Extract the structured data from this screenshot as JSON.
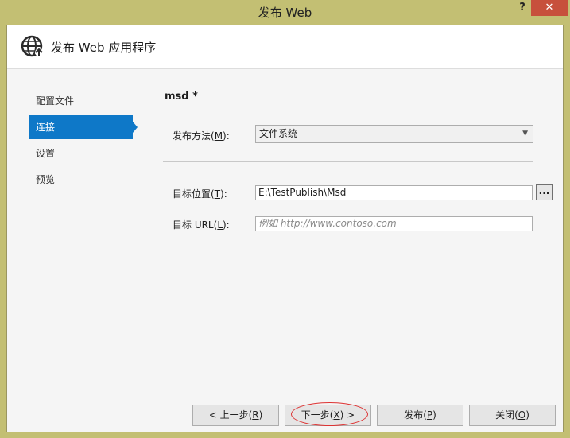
{
  "window": {
    "title": "发布 Web",
    "help_label": "?",
    "close_label": "✕"
  },
  "header": {
    "title": "发布 Web 应用程序",
    "icon": "globe-publish-icon"
  },
  "nav": {
    "items": [
      {
        "label": "配置文件",
        "active": false
      },
      {
        "label": "连接",
        "active": true
      },
      {
        "label": "设置",
        "active": false
      },
      {
        "label": "预览",
        "active": false
      }
    ]
  },
  "main": {
    "profile_name": "msd *",
    "publish_method": {
      "label_pre": "发布方法(",
      "label_key": "M",
      "label_post": "):",
      "value": "文件系统"
    },
    "target_location": {
      "label_pre": "目标位置(",
      "label_key": "T",
      "label_post": "):",
      "value": "E:\\TestPublish\\Msd",
      "browse_label": "..."
    },
    "target_url": {
      "label_pre": "目标 URL(",
      "label_key": "L",
      "label_post": "):",
      "value": "",
      "placeholder": "例如 http://www.contoso.com"
    }
  },
  "footer": {
    "prev": {
      "pre": "< 上一步(",
      "key": "R",
      "post": ")"
    },
    "next": {
      "pre": "下一步(",
      "key": "X",
      "post": ") >"
    },
    "publish": {
      "pre": "发布(",
      "key": "P",
      "post": ")"
    },
    "close": {
      "pre": "关闭(",
      "key": "O",
      "post": ")"
    }
  },
  "colors": {
    "accent": "#0e78c8",
    "annotation": "#dd3333",
    "titlebar": "#c3bf73"
  }
}
